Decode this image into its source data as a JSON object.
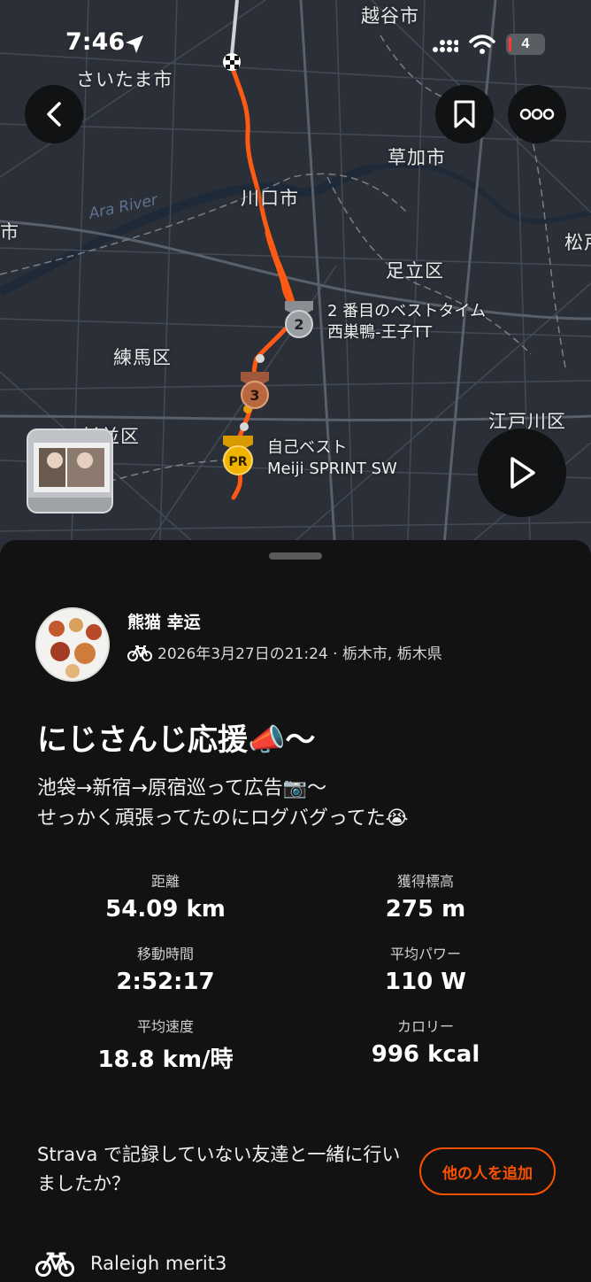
{
  "status_bar": {
    "time": "7:46",
    "battery": "4"
  },
  "map": {
    "place_labels": [
      "さいたま市",
      "越谷市",
      "草加市",
      "川口市",
      "足立区",
      "練馬区",
      "江戸川区",
      "杉並区",
      "松戸",
      "志木市"
    ],
    "river_label": "Ara River",
    "segments": [
      {
        "badge": "2",
        "label_line1": "2 番目のベストタイム",
        "label_line2": "西巣鴨-王子TT"
      },
      {
        "badge": "3"
      },
      {
        "badge": "PR",
        "label_line1": "自己ベスト",
        "label_line2": "Meiji SPRINT  SW"
      }
    ]
  },
  "activity": {
    "athlete_name": "熊猫 幸运",
    "meta": "2026年3月27日の21:24 · 栃木市, 栃木県",
    "title": "にじさんじ応援📣〜",
    "description_line1": "池袋→新宿→原宿巡って広告📷〜",
    "description_line2": "せっかく頑張ってたのにログバグってた😭"
  },
  "stats": [
    {
      "label": "距離",
      "value": "54.09 km"
    },
    {
      "label": "獲得標高",
      "value": "275 m"
    },
    {
      "label": "移動時間",
      "value": "2:52:17"
    },
    {
      "label": "平均パワー",
      "value": "110 W"
    },
    {
      "label": "平均速度",
      "value": "18.8 km/時"
    },
    {
      "label": "カロリー",
      "value": "996 kcal"
    }
  ],
  "friends": {
    "text": "Strava で記録していない友達と一緒に行いましたか？",
    "add_button": "他の人を追加"
  },
  "gear": {
    "name": "Raleigh merit3"
  },
  "colors": {
    "accent": "#fc5200",
    "route": "#ff5a14",
    "background": "#121212"
  }
}
